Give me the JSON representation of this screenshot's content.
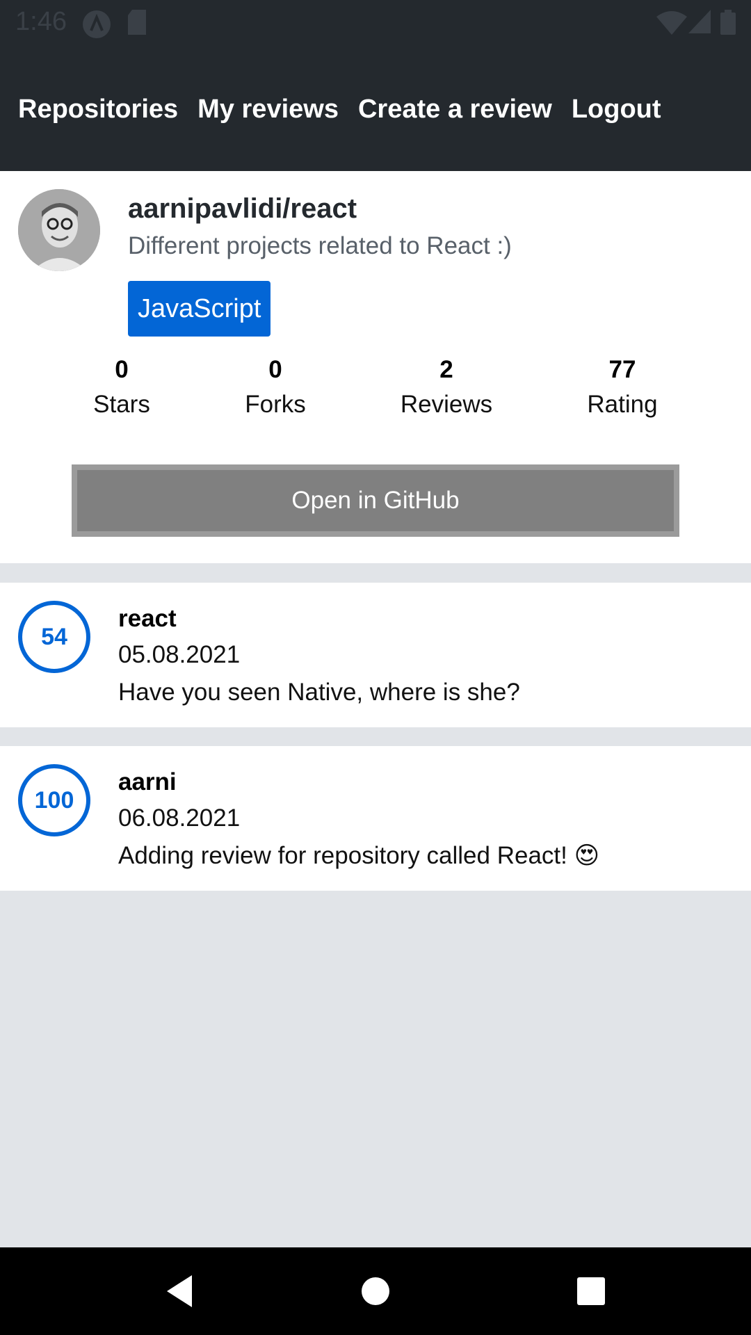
{
  "status_bar": {
    "time": "1:46",
    "icons": [
      "a-logo-icon",
      "sd-card-icon",
      "wifi-icon",
      "signal-icon",
      "battery-icon"
    ]
  },
  "nav": {
    "tabs": [
      "Repositories",
      "My reviews",
      "Create a review",
      "Logout"
    ]
  },
  "repository": {
    "full_name": "aarnipavlidi/react",
    "description": "Different projects related to React :)",
    "language": "JavaScript",
    "stats": [
      {
        "value": "0",
        "label": "Stars"
      },
      {
        "value": "0",
        "label": "Forks"
      },
      {
        "value": "2",
        "label": "Reviews"
      },
      {
        "value": "77",
        "label": "Rating"
      }
    ],
    "open_button": "Open in GitHub"
  },
  "reviews": [
    {
      "rating": "54",
      "user": "react",
      "date": "05.08.2021",
      "text": "Have you seen Native, where is she?"
    },
    {
      "rating": "100",
      "user": "aarni",
      "date": "06.08.2021",
      "text": "Adding review for repository called React! 😍"
    }
  ],
  "colors": {
    "header": "#24292e",
    "primary": "#0366d6",
    "background": "#e1e4e8",
    "button_gray": "#808080"
  },
  "system_nav": [
    "back-icon",
    "home-icon",
    "recents-icon"
  ]
}
